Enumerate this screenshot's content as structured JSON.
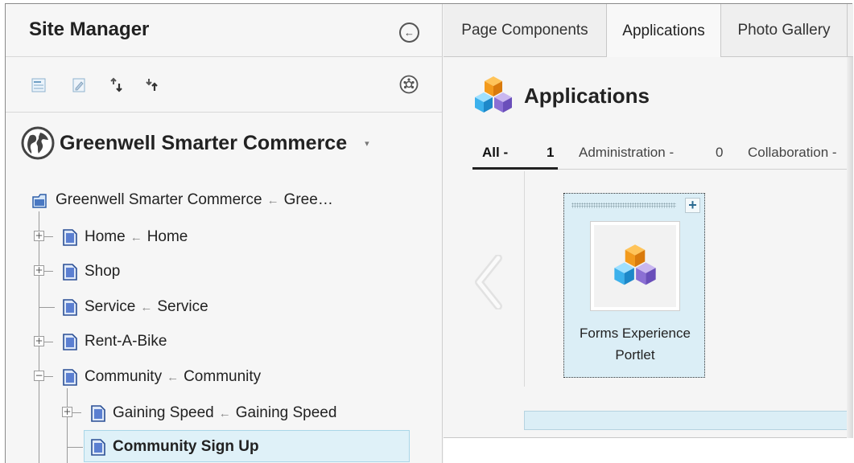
{
  "sidebar": {
    "title": "Site Manager",
    "toolbar_icons": [
      "page-list-icon",
      "edit-page-icon",
      "move-down-icon",
      "move-up-icon"
    ],
    "settings_icon": "gear-icon",
    "collapse_icon": "circle-arrow-left-icon",
    "site": {
      "name": "Greenwell Smarter Commerce",
      "icon": "globe-icon",
      "caret": "▾"
    },
    "tree": {
      "root": {
        "label": "Greenwell Smarter Commerce",
        "alias": "Gree…"
      },
      "items": [
        {
          "label": "Home",
          "alias": "Home",
          "expandable": true
        },
        {
          "label": "Shop",
          "alias": "",
          "expandable": true
        },
        {
          "label": "Service",
          "alias": "Service",
          "expandable": false
        },
        {
          "label": "Rent-A-Bike",
          "alias": "",
          "expandable": true
        },
        {
          "label": "Community",
          "alias": "Community",
          "expandable": true,
          "expanded": true
        },
        {
          "label": "Gaining Speed",
          "alias": "Gaining Speed",
          "expandable": true,
          "level": 2
        },
        {
          "label": "Community Sign Up",
          "alias": "",
          "selected": true,
          "level": 2
        }
      ],
      "alias_arrow": "←"
    }
  },
  "main": {
    "tabs": [
      {
        "label": "Page Components",
        "active": false
      },
      {
        "label": "Applications",
        "active": true
      },
      {
        "label": "Photo Gallery",
        "active": false
      }
    ],
    "header": {
      "title": "Applications",
      "icon": "cubes-icon"
    },
    "filters": [
      {
        "label": "All",
        "separator": "-",
        "count": "1",
        "active": true
      },
      {
        "label": "Administration",
        "separator": "-",
        "count": "0",
        "active": false
      },
      {
        "label": "Collaboration",
        "separator": "-",
        "count": "",
        "active": false
      }
    ],
    "cards": [
      {
        "line1": "Forms Experience",
        "line2": "Portlet",
        "icon": "cubes-icon",
        "add_label": "+"
      }
    ],
    "prev_icon": "chevron-left-icon"
  },
  "colors": {
    "accent": "#2b6a91",
    "selection_bg": "#dff1f8",
    "card_bg": "#dbeef6",
    "page_icon": "#3b6bc0"
  }
}
